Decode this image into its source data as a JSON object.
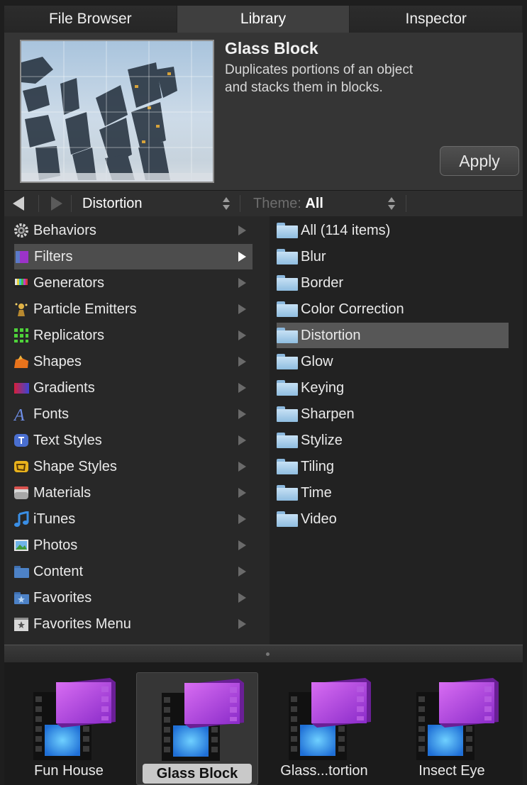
{
  "tabs": [
    {
      "label": "File Browser",
      "active": false
    },
    {
      "label": "Library",
      "active": true
    },
    {
      "label": "Inspector",
      "active": false
    }
  ],
  "preview": {
    "title": "Glass Block",
    "description": "Duplicates portions of an object and stacks them in blocks.",
    "apply_label": "Apply"
  },
  "nav": {
    "category": "Distortion",
    "theme_label": "Theme:",
    "theme_value": "All"
  },
  "categories": [
    {
      "label": "Behaviors",
      "icon": "gear-icon"
    },
    {
      "label": "Filters",
      "icon": "filters-icon",
      "selected": true
    },
    {
      "label": "Generators",
      "icon": "generators-icon"
    },
    {
      "label": "Particle Emitters",
      "icon": "particle-emitters-icon"
    },
    {
      "label": "Replicators",
      "icon": "replicators-icon"
    },
    {
      "label": "Shapes",
      "icon": "shapes-icon"
    },
    {
      "label": "Gradients",
      "icon": "gradients-icon"
    },
    {
      "label": "Fonts",
      "icon": "fonts-icon"
    },
    {
      "label": "Text Styles",
      "icon": "text-styles-icon"
    },
    {
      "label": "Shape Styles",
      "icon": "shape-styles-icon"
    },
    {
      "label": "Materials",
      "icon": "materials-icon"
    },
    {
      "label": "iTunes",
      "icon": "itunes-icon"
    },
    {
      "label": "Photos",
      "icon": "photos-icon"
    },
    {
      "label": "Content",
      "icon": "content-icon"
    },
    {
      "label": "Favorites",
      "icon": "favorites-icon"
    },
    {
      "label": "Favorites Menu",
      "icon": "favorites-menu-icon"
    }
  ],
  "subcategories": [
    {
      "label": "All (114 items)"
    },
    {
      "label": "Blur"
    },
    {
      "label": "Border"
    },
    {
      "label": "Color Correction"
    },
    {
      "label": "Distortion",
      "selected": true
    },
    {
      "label": "Glow"
    },
    {
      "label": "Keying"
    },
    {
      "label": "Sharpen"
    },
    {
      "label": "Stylize"
    },
    {
      "label": "Tiling"
    },
    {
      "label": "Time"
    },
    {
      "label": "Video"
    }
  ],
  "items": [
    {
      "label": "Fun House",
      "selected": false
    },
    {
      "label": "Glass Block",
      "selected": true
    },
    {
      "label": "Glass...tortion",
      "selected": false
    },
    {
      "label": "Insect Eye",
      "selected": false
    }
  ]
}
